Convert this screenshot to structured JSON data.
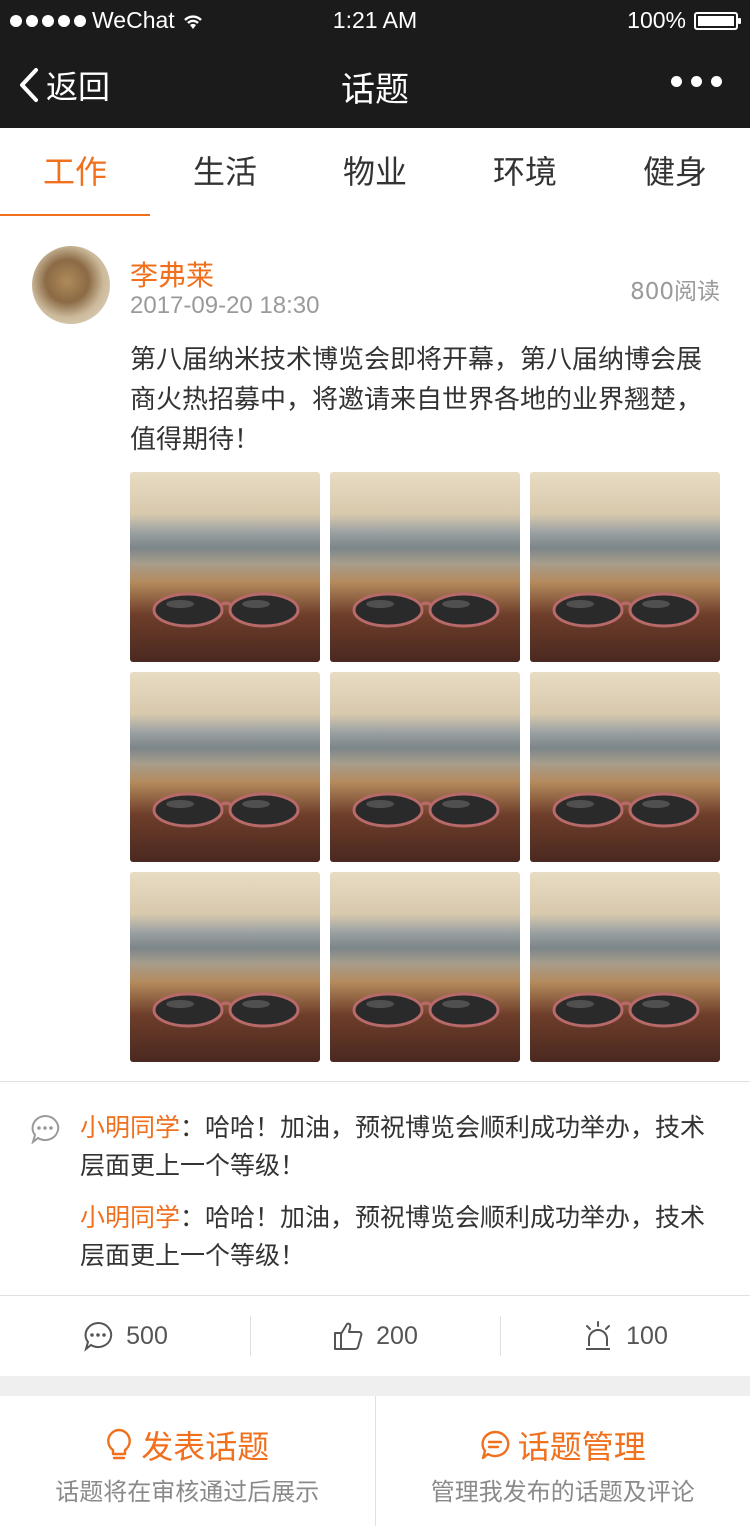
{
  "status_bar": {
    "carrier": "WeChat",
    "time": "1:21 AM",
    "battery": "100%"
  },
  "nav": {
    "back_label": "返回",
    "title": "话题"
  },
  "tabs": [
    {
      "label": "工作",
      "active": true
    },
    {
      "label": "生活",
      "active": false
    },
    {
      "label": "物业",
      "active": false
    },
    {
      "label": "环境",
      "active": false
    },
    {
      "label": "健身",
      "active": false
    }
  ],
  "post": {
    "author": "李弗莱",
    "time": "2017-09-20 18:30",
    "reads": "800阅读",
    "content": "第八届纳米技术博览会即将开幕，第八届纳博会展商火热招募中，将邀请来自世界各地的业界翘楚，值得期待！",
    "photo_count": 9
  },
  "comments": [
    {
      "name": "小明同学",
      "sep": "：",
      "text": "哈哈！加油，预祝博览会顺利成功举办，技术层面更上一个等级！"
    },
    {
      "name": "小明同学",
      "sep": "：",
      "text": "哈哈！加油，预祝博览会顺利成功举办，技术层面更上一个等级！"
    }
  ],
  "stats": {
    "comments": "500",
    "likes": "200",
    "alerts": "100"
  },
  "actions": [
    {
      "title": "发表话题",
      "subtitle": "话题将在审核通过后展示",
      "icon": "lightbulb-icon"
    },
    {
      "title": "话题管理",
      "subtitle": "管理我发布的话题及评论",
      "icon": "chat-bubble-icon"
    }
  ],
  "colors": {
    "accent": "#f0701e",
    "header_bg": "#1b1b1b"
  }
}
